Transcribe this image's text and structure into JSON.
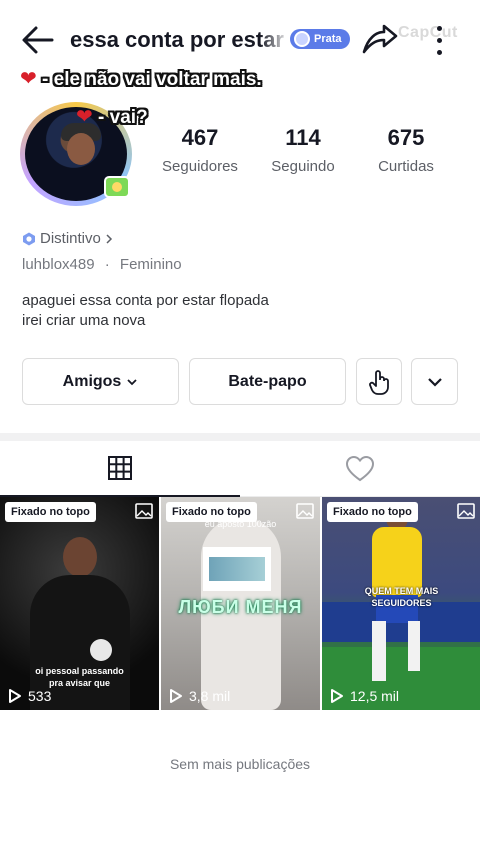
{
  "header": {
    "title": "essa conta por estar f",
    "badge": "Prata",
    "watermark": "CapCut"
  },
  "overlay": {
    "line1": "- ele não vai voltar mais.",
    "line2": "- vai?",
    "heart": "❤"
  },
  "stats": [
    {
      "value": "467",
      "label": "Seguidores"
    },
    {
      "value": "114",
      "label": "Seguindo"
    },
    {
      "value": "675",
      "label": "Curtidas"
    }
  ],
  "profile": {
    "distintivo": "Distintivo",
    "username": "luhblox489",
    "separator": "·",
    "gender": "Feminino",
    "bio_line1": "apaguei essa conta por estar flopada",
    "bio_line2": "irei criar uma nova"
  },
  "buttons": {
    "friends": "Amigos",
    "chat": "Bate-papo"
  },
  "posts": [
    {
      "pin": "Fixado no topo",
      "views": "533",
      "caption": "oi pessoal passando\npra avisar que"
    },
    {
      "pin": "Fixado no topo",
      "views": "3,8 mil",
      "caption_top": "eu aposto 100zão",
      "caption_big": "ЛЮБИ МЕНЯ"
    },
    {
      "pin": "Fixado no topo",
      "views": "12,5 mil",
      "caption": "QUEM TEM MAIS\nSEGUIDORES"
    }
  ],
  "footer": {
    "no_more": "Sem mais publicações"
  },
  "colors": {
    "text": "#161823",
    "secondary": "#5c5f66",
    "badge": "#5b7be8",
    "divider": "#f1f1f2"
  }
}
